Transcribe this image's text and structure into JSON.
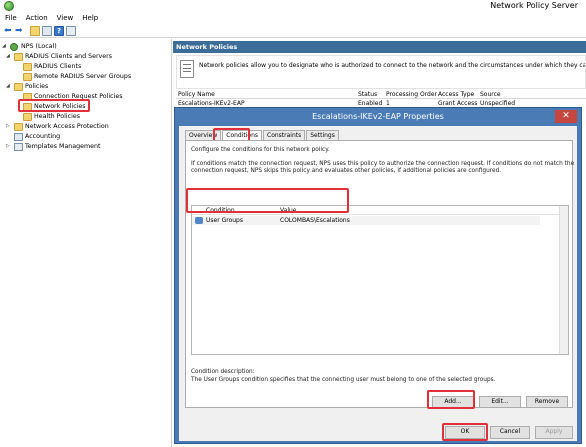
{
  "window": {
    "title": "Network Policy Server"
  },
  "menu": [
    "File",
    "Action",
    "View",
    "Help"
  ],
  "tree": {
    "nodes": [
      {
        "label": "NPS (Local)"
      },
      {
        "label": "RADIUS Clients and Servers"
      },
      {
        "label": "RADIUS Clients"
      },
      {
        "label": "Remote RADIUS Server Groups"
      },
      {
        "label": "Policies"
      },
      {
        "label": "Connection Request Policies"
      },
      {
        "label": "Network Policies"
      },
      {
        "label": "Health Policies"
      },
      {
        "label": "Network Access Protection"
      },
      {
        "label": "Accounting"
      },
      {
        "label": "Templates Management"
      }
    ]
  },
  "main": {
    "header": "Network Policies",
    "description": "Network policies allow you to designate who is authorized to connect to the network and the circumstances under which they can or cannot connect",
    "columns": [
      "Policy Name",
      "Status",
      "Processing Order",
      "Access Type",
      "Source"
    ],
    "row": [
      "Escalations-IKEv2-EAP",
      "Enabled",
      "1",
      "Grant Access",
      "Unspecified"
    ]
  },
  "dialog": {
    "title": "Escalations-IKEv2-EAP Properties",
    "close": "✕",
    "tabs": [
      "Overview",
      "Conditions",
      "Constraints",
      "Settings"
    ],
    "intro": "Configure the conditions for this network policy.",
    "explain1": "If conditions match the connection request, NPS uses this policy to authorize the connection request. If conditions do not match the",
    "explain2": "connection request, NPS skips this policy and evaluates other policies, if additional policies are configured.",
    "cond_headers": [
      "Condition",
      "Value"
    ],
    "cond_row": [
      "User Groups",
      "COLOMBAS\\Escalations"
    ],
    "cond_desc_label": "Condition description:",
    "cond_desc_text": "The User Groups condition specifies that the connecting user must belong to one of the selected groups.",
    "add": "Add...",
    "edit": "Edit...",
    "remove": "Remove",
    "ok": "OK",
    "cancel": "Cancel",
    "apply": "Apply"
  }
}
